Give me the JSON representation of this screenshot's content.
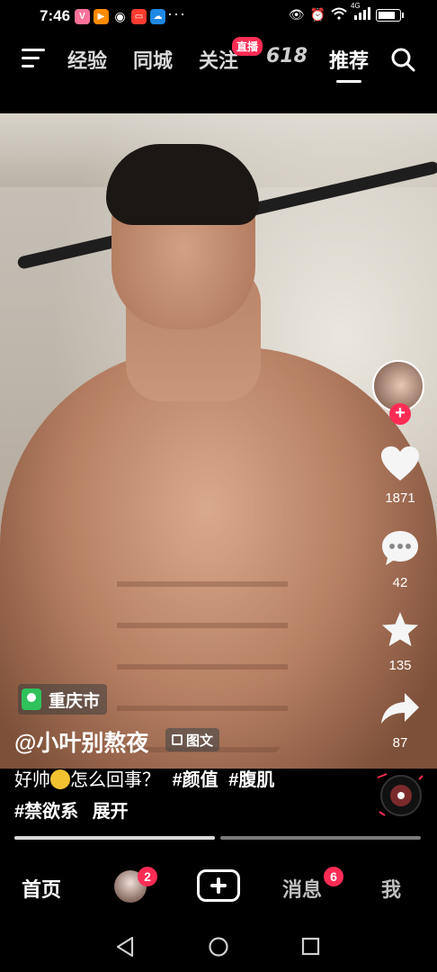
{
  "status_bar": {
    "time": "7:46",
    "app_icons": [
      {
        "name": "bilibili-app-icon",
        "color": "#fb7299",
        "glyph": "V"
      },
      {
        "name": "video-app-icon",
        "color": "#ff8a00",
        "glyph": "▶"
      },
      {
        "name": "qq-app-icon",
        "color": "#444444",
        "glyph": "◐"
      },
      {
        "name": "mail-app-icon",
        "color": "#ff3b30",
        "glyph": "▭"
      },
      {
        "name": "weather-app-icon",
        "color": "#1e88e5",
        "glyph": "☁"
      }
    ],
    "more": "···",
    "signal_label": "4G",
    "battery_level": 0.7
  },
  "top_nav": {
    "tabs": [
      "经验",
      "同城",
      "关注",
      "618",
      "推荐"
    ],
    "active_tab": "推荐",
    "live_badge": "直播"
  },
  "side_actions": {
    "likes": "1871",
    "comments": "42",
    "favorites": "135",
    "shares": "87",
    "follow_symbol": "+"
  },
  "post": {
    "location": "重庆市",
    "author": "@小叶别熬夜",
    "type_tag": "图文",
    "caption_line1_prefix": "好帅",
    "caption_line1_suffix": "怎么回事？",
    "hashtag1": "#颜值",
    "hashtag2": "#腹肌",
    "hashtag3": "#禁欲系",
    "expand": "展开",
    "progress": [
      1.0,
      0.0
    ]
  },
  "bottom_nav": {
    "home": "首页",
    "friends_badge": "2",
    "messages": "消息",
    "messages_badge": "6",
    "me": "我"
  },
  "colors": {
    "accent": "#fe2c55",
    "location_green": "#2fc25b"
  }
}
